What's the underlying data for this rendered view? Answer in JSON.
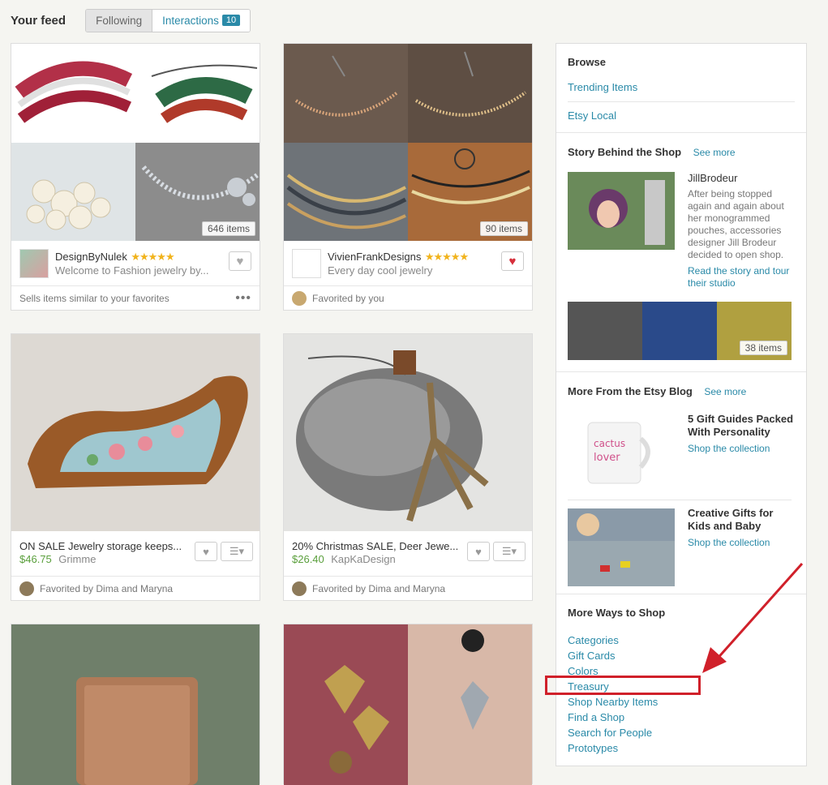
{
  "header": {
    "title": "Your feed",
    "tab_following": "Following",
    "tab_interactions": "Interactions",
    "interactions_count": "10"
  },
  "cards": [
    {
      "count": "646 items",
      "shop": "DesignByNulek",
      "stars": "★★★★★",
      "desc": "Welcome to Fashion jewelry by...",
      "footer": "Sells items similar to your favorites"
    },
    {
      "count": "90 items",
      "shop": "VivienFrankDesigns",
      "stars": "★★★★★",
      "desc": "Every day cool jewelry",
      "footer": "Favorited by you"
    },
    {
      "title": "ON SALE Jewelry storage keeps...",
      "price": "$46.75",
      "shop": "Grimme",
      "footer": "Favorited by Dima and Maryna"
    },
    {
      "title": "20% Christmas SALE, Deer Jewe...",
      "price": "$26.40",
      "shop": "KapKaDesign",
      "footer": "Favorited by Dima and Maryna"
    }
  ],
  "sidebar": {
    "browse": {
      "title": "Browse",
      "links": [
        "Trending Items",
        "Etsy Local"
      ]
    },
    "story": {
      "title": "Story Behind the Shop",
      "see_more": "See more",
      "name": "JillBrodeur",
      "text": "After being stopped again and again about her monogrammed pouches, accessories designer Jill Brodeur decided to open shop.",
      "link": "Read the story and tour their studio",
      "count": "38 items"
    },
    "blog": {
      "title": "More From the Etsy Blog",
      "see_more": "See more",
      "posts": [
        {
          "title": "5 Gift Guides Packed With Personality",
          "link": "Shop the collection"
        },
        {
          "title": "Creative Gifts for Kids and Baby",
          "link": "Shop the collection"
        }
      ]
    },
    "ways": {
      "title": "More Ways to Shop",
      "links": [
        "Categories",
        "Gift Cards",
        "Colors",
        "Treasury",
        "Shop Nearby Items",
        "Find a Shop",
        "Search for People",
        "Prototypes"
      ]
    }
  },
  "colors": {
    "accent": "#2a8aa8",
    "price": "#5a9f3c",
    "star": "#f1b31c",
    "highlight": "#d0202a"
  }
}
